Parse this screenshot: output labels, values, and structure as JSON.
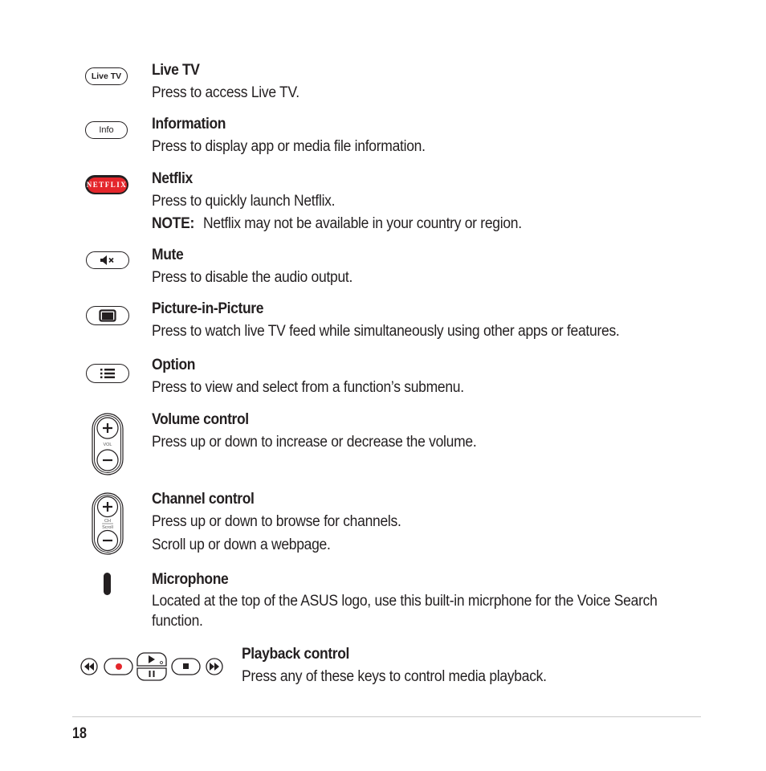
{
  "entries": [
    {
      "icon": "live-tv-button-icon",
      "icon_label": "Live TV",
      "title": "Live TV",
      "desc": "Press to access Live TV."
    },
    {
      "icon": "info-button-icon",
      "icon_label": "Info",
      "title": "Information",
      "desc": "Press to display app or media file information."
    },
    {
      "icon": "netflix-button-icon",
      "icon_label": "NETFLIX",
      "title": "Netflix",
      "desc": "Press to quickly launch Netflix.",
      "note_label": "NOTE:",
      "note_text": "Netflix may not be available in your country or region.",
      "brand_color": "#e4262b"
    },
    {
      "icon": "mute-button-icon",
      "title": "Mute",
      "desc": "Press to disable the audio output."
    },
    {
      "icon": "picture-in-picture-button-icon",
      "title": "Picture-in-Picture",
      "desc": "Press to watch live TV feed while simultaneously using other apps or features."
    },
    {
      "icon": "option-button-icon",
      "title": "Option",
      "desc": "Press to view and select from a function’s submenu."
    },
    {
      "icon": "volume-rocker-icon",
      "icon_label": "VOL",
      "title": "Volume control",
      "desc": "Press up or down to increase or decrease the volume."
    },
    {
      "icon": "channel-rocker-icon",
      "icon_label_top": "CH",
      "icon_label_bottom": "Scroll",
      "title": "Channel control",
      "desc": "Press up or down to browse for channels.",
      "desc2": "Scroll up or down a webpage."
    },
    {
      "icon": "microphone-icon",
      "title": "Microphone",
      "desc": "Located at the top of the ASUS logo, use this built-in micrphone for the Voice Search function."
    },
    {
      "icon": "playback-keys-icon",
      "title": "Playback control",
      "desc": "Press any of these keys to control media playback.",
      "record_color": "#e4262b"
    }
  ],
  "footer": {
    "page_number": "18"
  }
}
